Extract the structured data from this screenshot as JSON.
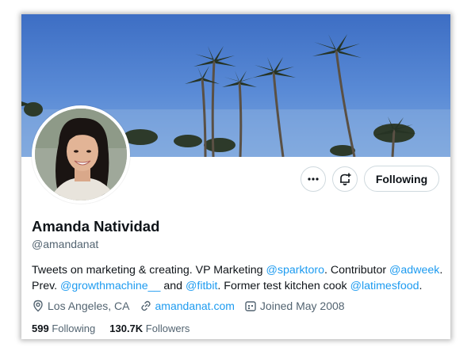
{
  "profile": {
    "name": "Amanda Natividad",
    "handle": "@amandanat",
    "bio": [
      {
        "text": "Tweets on marketing & creating. VP Marketing ",
        "link": false
      },
      {
        "text": "@sparktoro",
        "link": true
      },
      {
        "text": ". Contributor ",
        "link": false
      },
      {
        "text": "@adweek",
        "link": true
      },
      {
        "text": ".",
        "link": false
      },
      {
        "text": "Prev. ",
        "link": false
      },
      {
        "text": "@growthmachine__",
        "link": true
      },
      {
        "text": " and ",
        "link": false
      },
      {
        "text": "@fitbit",
        "link": true
      },
      {
        "text": ". Former test kitchen cook ",
        "link": false
      },
      {
        "text": "@latimesfood",
        "link": true
      },
      {
        "text": ".",
        "link": false
      }
    ],
    "location": "Los Angeles, CA",
    "website": "amandanat.com",
    "joined": "Joined May 2008",
    "following_count": "599",
    "following_label": "Following",
    "followers_count": "130.7K",
    "followers_label": "Followers"
  },
  "actions": {
    "more_icon": "ellipsis-icon",
    "notify_icon": "bell-plus-icon",
    "following_button": "Following"
  },
  "colors": {
    "link": "#1d9bf0",
    "text": "#0f1419",
    "secondary": "#536471",
    "sky": "#4a7bcc"
  }
}
